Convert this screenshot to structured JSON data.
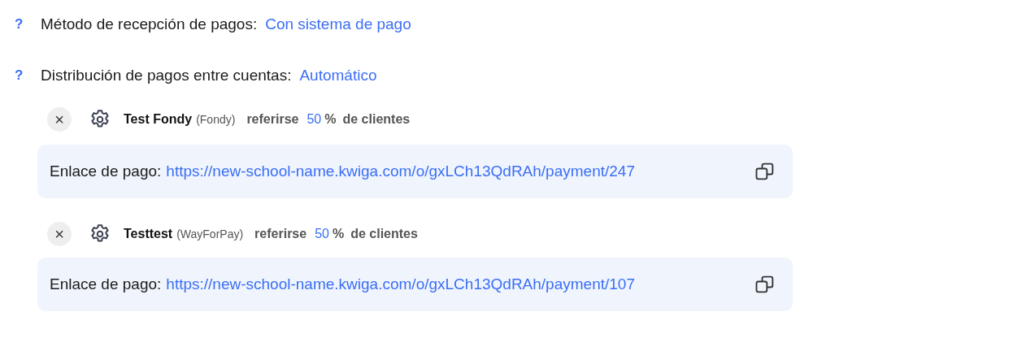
{
  "settings": [
    {
      "help": "?",
      "label": "Método de recepción de pagos:",
      "value": "Con sistema de pago"
    },
    {
      "help": "?",
      "label": "Distribución de pagos entre cuentas:",
      "value": "Automático"
    }
  ],
  "accounts": [
    {
      "remove": "×",
      "name": "Test Fondy",
      "provider": "(Fondy)",
      "refer_label": "referirse",
      "percent": "50",
      "percent_sign": "%",
      "suffix": "de clientes",
      "link_label": "Enlace de pago:",
      "link": "https://new-school-name.kwiga.com/o/gxLCh13QdRAh/payment/247"
    },
    {
      "remove": "×",
      "name": "Testtest",
      "provider": "(WayForPay)",
      "refer_label": "referirse",
      "percent": "50",
      "percent_sign": "%",
      "suffix": "de clientes",
      "link_label": "Enlace de pago:",
      "link": "https://new-school-name.kwiga.com/o/gxLCh13QdRAh/payment/107"
    }
  ]
}
